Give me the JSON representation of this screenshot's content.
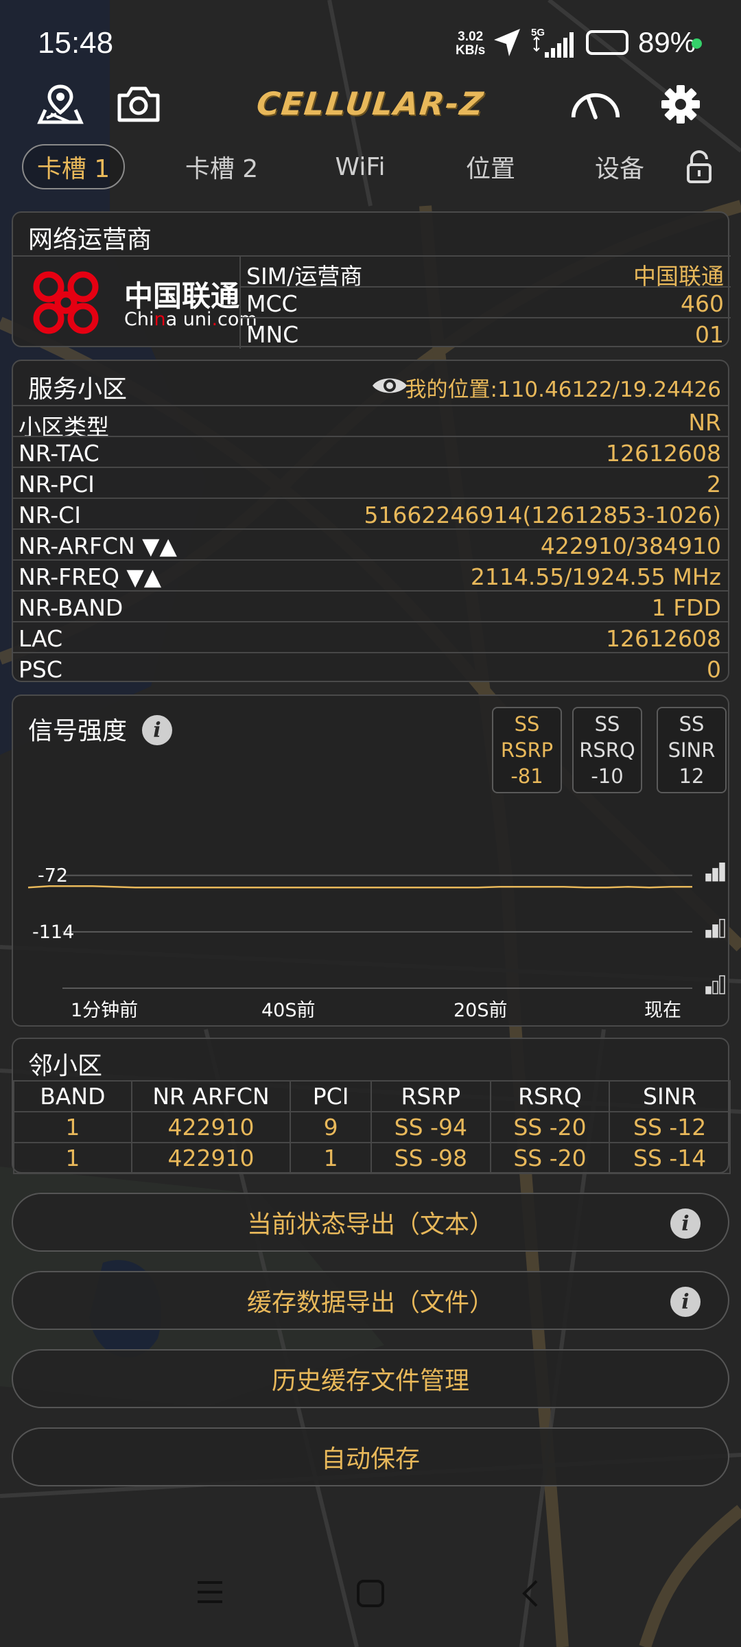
{
  "status_bar": {
    "time": "15:48",
    "speed_value": "3.02",
    "speed_unit": "KB/s",
    "network": "5G",
    "battery_percent": "89%"
  },
  "toolbar": {
    "app_title": "CELLULAR-Z",
    "icons": [
      "map-location-icon",
      "camera-icon",
      "speedometer-icon",
      "gear-icon"
    ]
  },
  "tabs": [
    {
      "label": "卡槽 1",
      "active": true
    },
    {
      "label": "卡槽 2",
      "active": false
    },
    {
      "label": "WiFi",
      "active": false
    },
    {
      "label": "位置",
      "active": false
    },
    {
      "label": "设备",
      "active": false
    }
  ],
  "operator": {
    "title": "网络运营商",
    "logo_cn": "中国联通",
    "logo_en_pre": "Chi",
    "logo_en_mid": "n",
    "logo_en_post": "a uni",
    "logo_en_end": "com",
    "rows": [
      {
        "key": "SIM/运营商",
        "value": "中国联通"
      },
      {
        "key": "MCC",
        "value": "460"
      },
      {
        "key": "MNC",
        "value": "01"
      }
    ]
  },
  "serving_cell": {
    "title": "服务小区",
    "location": "我的位置:110.46122/19.24426",
    "rows": [
      {
        "key": "小区类型",
        "value": "NR"
      },
      {
        "key": "NR-TAC",
        "value": "12612608"
      },
      {
        "key": "NR-PCI",
        "value": "2"
      },
      {
        "key": "NR-CI",
        "value": "51662246914(12612853-1026)"
      },
      {
        "key": "NR-ARFCN ▼▲",
        "value": "422910/384910"
      },
      {
        "key": "NR-FREQ ▼▲",
        "value": "2114.55/1924.55 MHz"
      },
      {
        "key": "NR-BAND",
        "value": "1 FDD"
      },
      {
        "key": "LAC",
        "value": "12612608"
      },
      {
        "key": "PSC",
        "value": "0"
      }
    ]
  },
  "signal": {
    "title": "信号强度",
    "metrics": [
      {
        "line1": "SS",
        "line2": "RSRP",
        "value": "-81",
        "highlight": true
      },
      {
        "line1": "SS",
        "line2": "RSRQ",
        "value": "-10",
        "highlight": false
      },
      {
        "line1": "SS",
        "line2": "SINR",
        "value": "12",
        "highlight": false
      }
    ]
  },
  "chart_data": {
    "type": "line",
    "x_tick_labels": [
      "1分钟前",
      "40S前",
      "20S前",
      "现在"
    ],
    "y_tick_labels": [
      "-72",
      "-114"
    ],
    "y_ticks": [
      -72,
      -114
    ],
    "series": [
      {
        "color": "#e8b85a",
        "values": [
          -81,
          -80,
          -80,
          -80,
          -80.5,
          -81,
          -81,
          -81,
          -81,
          -81,
          -81,
          -81,
          -81,
          -81,
          -81,
          -81,
          -81,
          -81,
          -81,
          -81,
          -81,
          -81,
          -80.5,
          -80.5,
          -80.5,
          -80.5,
          -81,
          -81,
          -80.5,
          -81,
          -80.5,
          -80.5
        ]
      }
    ],
    "ylim": [
      -156,
      -64
    ],
    "grid": true
  },
  "neighbors": {
    "title": "邻小区",
    "headers": [
      "BAND",
      "NR ARFCN",
      "PCI",
      "RSRP",
      "RSRQ",
      "SINR"
    ],
    "rows": [
      [
        "1",
        "422910",
        "9",
        "SS -94",
        "SS -20",
        "SS -12"
      ],
      [
        "1",
        "422910",
        "1",
        "SS -98",
        "SS -20",
        "SS -14"
      ]
    ]
  },
  "actions": {
    "export_text": "当前状态导出（文本）",
    "export_file": "缓存数据导出（文件）",
    "history": "历史缓存文件管理",
    "autosave": "自动保存"
  }
}
